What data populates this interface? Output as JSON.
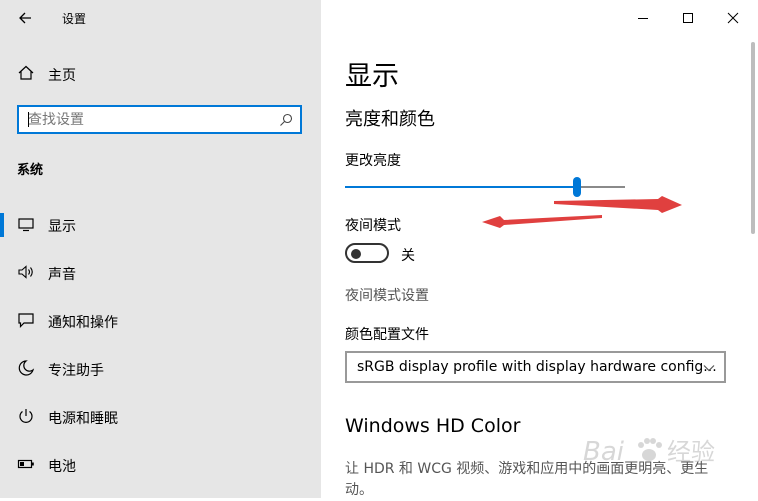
{
  "window": {
    "app_title": "设置",
    "controls": [
      "minimize-icon",
      "maximize-icon",
      "close-icon"
    ]
  },
  "sidebar": {
    "home_label": "主页",
    "search_placeholder": "查找设置",
    "section_heading": "系统",
    "items": [
      {
        "label": "显示",
        "icon": "monitor-icon",
        "active": true
      },
      {
        "label": "声音",
        "icon": "speaker-icon",
        "active": false
      },
      {
        "label": "通知和操作",
        "icon": "notification-icon",
        "active": false
      },
      {
        "label": "专注助手",
        "icon": "moon-icon",
        "active": false
      },
      {
        "label": "电源和睡眠",
        "icon": "power-icon",
        "active": false
      },
      {
        "label": "电池",
        "icon": "battery-icon",
        "active": false
      }
    ]
  },
  "main": {
    "title": "显示",
    "section_title": "亮度和颜色",
    "brightness": {
      "label": "更改亮度",
      "value": 0.83
    },
    "night_mode": {
      "label": "夜间模式",
      "state_label": "关",
      "on": false
    },
    "night_mode_settings_link": "夜间模式设置",
    "color_profile": {
      "label": "颜色配置文件",
      "selected": "sRGB display profile with display hardware config..."
    },
    "hd_color": {
      "title": "Windows HD Color",
      "description": "让 HDR 和 WCG 视频、游戏和应用中的画面更明亮、更生动。"
    }
  },
  "colors": {
    "accent": "#0078d7",
    "sidebar_bg": "#e6e6e6",
    "annotation_arrow": "#e0403f"
  },
  "watermark": {
    "brand": "Bai",
    "suffix": "经验"
  }
}
